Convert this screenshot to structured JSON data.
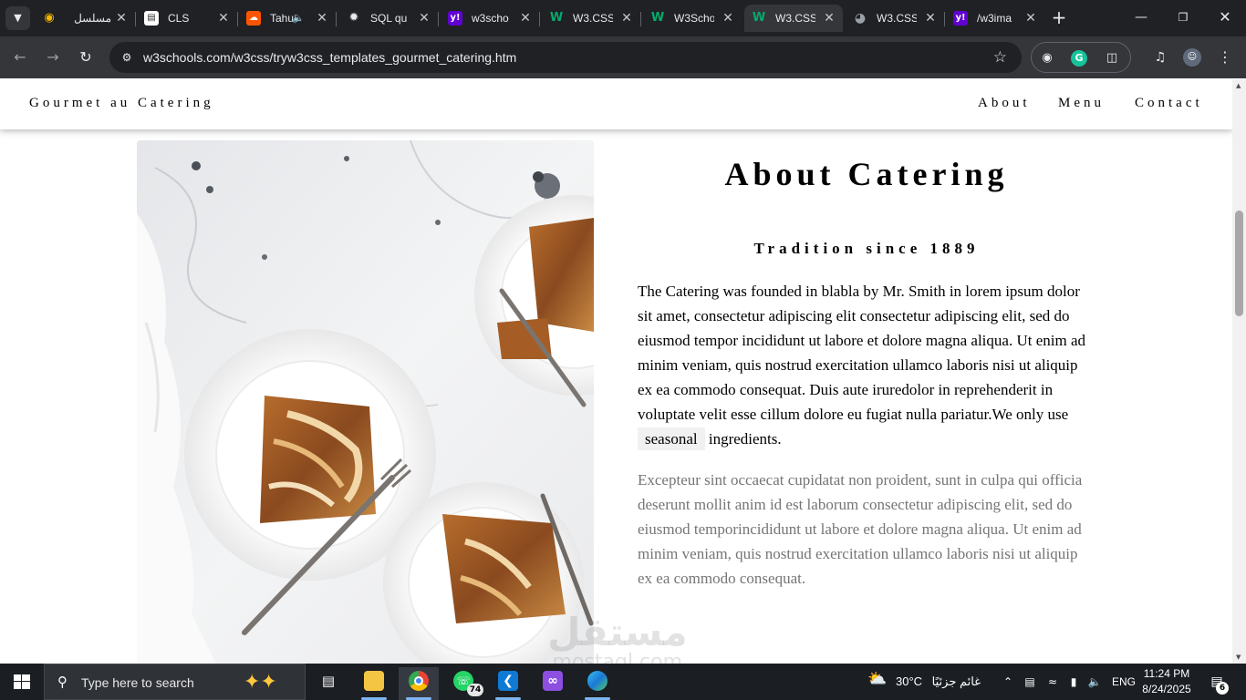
{
  "browser": {
    "tabs": [
      {
        "title": "مسلسل",
        "favicon": "eye-icon",
        "active": false
      },
      {
        "title": "CLS",
        "favicon": "document-icon",
        "active": false
      },
      {
        "title": "Tahu",
        "favicon": "soundcloud-icon",
        "active": false,
        "audio": "speaker-icon"
      },
      {
        "title": "SQL qu",
        "favicon": "chatgpt-icon",
        "active": false
      },
      {
        "title": "w3scho",
        "favicon": "yahoo-icon",
        "active": false
      },
      {
        "title": "W3.CSS",
        "favicon": "w3schools-icon",
        "active": false
      },
      {
        "title": "W3Scho",
        "favicon": "w3schools-icon",
        "active": false
      },
      {
        "title": "W3.CSS",
        "favicon": "w3schools-icon",
        "active": true
      },
      {
        "title": "W3.CSS",
        "favicon": "globe-icon",
        "active": false
      },
      {
        "title": "/w3ima",
        "favicon": "yahoo-icon",
        "active": false
      }
    ],
    "url": "w3schools.com/w3css/tryw3css_templates_gourmet_catering.htm",
    "colors": {
      "tabbar": "#202124",
      "toolbar": "#35363a",
      "omnibox": "#202124"
    }
  },
  "site": {
    "brand": "Gourmet au Catering",
    "nav": [
      "About",
      "Menu",
      "Contact"
    ],
    "about": {
      "title": "About Catering",
      "subtitle": "Tradition since 1889",
      "para1_a": "The Catering was founded in blabla by Mr. Smith in lorem ipsum dolor sit amet, consectetur adipiscing elit consectetur adipiscing elit, sed do eiusmod tempor incididunt ut labore et dolore magna aliqua. Ut enim ad minim veniam, quis nostrud exercitation ullamco laboris nisi ut aliquip ex ea commodo consequat. Duis aute iruredolor in reprehenderit in voluptate velit esse cillum dolore eu fugiat nulla pariatur.We only use",
      "para1_tag": "seasonal",
      "para1_b": "ingredients.",
      "para2": "Excepteur sint occaecat cupidatat non proident, sunt in culpa qui officia deserunt mollit anim id est laborum consectetur adipiscing elit, sed do eiusmod temporincididunt ut labore et dolore magna aliqua. Ut enim ad minim veniam, quis nostrud exercitation ullamco laboris nisi ut aliquip ex ea commodo consequat."
    },
    "watermark": {
      "line1": "مستقل",
      "line2": "mostaql.com"
    }
  },
  "taskbar": {
    "search_placeholder": "Type here to search",
    "pinned": [
      "task-view-icon",
      "file-explorer-icon",
      "chrome-icon",
      "whatsapp-icon",
      "vscode-icon",
      "visual-studio-icon",
      "edge-icon"
    ],
    "whatsapp_badge": "74",
    "weather_temp": "30°C",
    "weather_text": "غائم جزئيًا",
    "language": "ENG",
    "time": "11:24 PM",
    "date": "8/24/2025",
    "notifications": "6"
  }
}
